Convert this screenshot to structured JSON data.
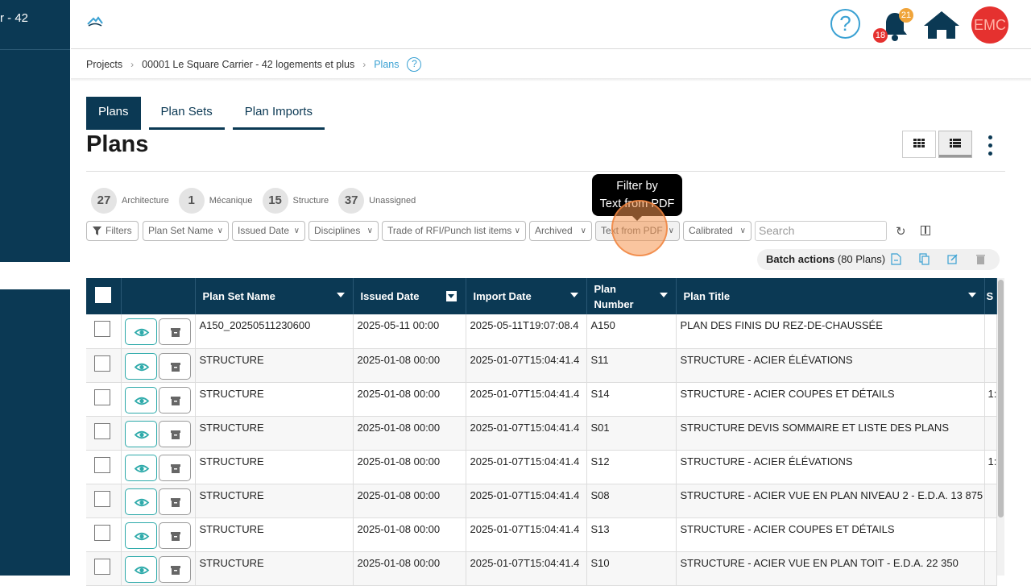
{
  "sidebar": {
    "project_fragment": "r - 42"
  },
  "header": {
    "help_label": "?",
    "notif_count": "21",
    "alert_count": "18",
    "avatar_initials": "EMC"
  },
  "breadcrumb": {
    "items": [
      "Projects",
      "00001 Le Square Carrier - 42 logements et plus",
      "Plans"
    ],
    "help": "?"
  },
  "tabs": [
    "Plans",
    "Plan Sets",
    "Plan Imports"
  ],
  "page_title": "Plans",
  "counts": [
    {
      "count": "27",
      "label": "Architecture"
    },
    {
      "count": "1",
      "label": "Mécanique"
    },
    {
      "count": "15",
      "label": "Structure"
    },
    {
      "count": "37",
      "label": "Unassigned"
    }
  ],
  "filters": {
    "filters_label": "Filters",
    "plan_set_name": "Plan Set Name",
    "issued_date": "Issued Date",
    "disciplines": "Disciplines",
    "trade": "Trade of RFI/Punch list items",
    "archived": "Archived",
    "text_from_pdf": "Text from PDF",
    "calibrated": "Calibrated",
    "search_placeholder": "Search"
  },
  "tooltip": {
    "line1": "Filter by",
    "line2": "Text from PDF"
  },
  "batch": {
    "label": "Batch actions",
    "count": "(80 Plans)"
  },
  "table": {
    "headers": [
      "Plan Set Name",
      "Issued Date",
      "Import Date",
      "Plan Number",
      "Plan Title",
      "S"
    ],
    "rows": [
      {
        "set": "A150_20250511230600",
        "issued": "2025-05-11 00:00",
        "imported": "2025-05-11T19:07:08.4",
        "number": "A150",
        "title": "PLAN DES FINIS DU REZ-DE-CHAUSSÉE",
        "extra": ""
      },
      {
        "set": "STRUCTURE",
        "issued": "2025-01-08 00:00",
        "imported": "2025-01-07T15:04:41.4",
        "number": "S11",
        "title": "STRUCTURE - ACIER ÉLÉVATIONS",
        "extra": ""
      },
      {
        "set": "STRUCTURE",
        "issued": "2025-01-08 00:00",
        "imported": "2025-01-07T15:04:41.4",
        "number": "S14",
        "title": "STRUCTURE - ACIER COUPES ET DÉTAILS",
        "extra": "1:"
      },
      {
        "set": "STRUCTURE",
        "issued": "2025-01-08 00:00",
        "imported": "2025-01-07T15:04:41.4",
        "number": "S01",
        "title": "STRUCTURE DEVIS SOMMAIRE ET LISTE DES PLANS",
        "extra": ""
      },
      {
        "set": "STRUCTURE",
        "issued": "2025-01-08 00:00",
        "imported": "2025-01-07T15:04:41.4",
        "number": "S12",
        "title": "STRUCTURE - ACIER ÉLÉVATIONS",
        "extra": "1:"
      },
      {
        "set": "STRUCTURE",
        "issued": "2025-01-08 00:00",
        "imported": "2025-01-07T15:04:41.4",
        "number": "S08",
        "title": "STRUCTURE - ACIER VUE EN PLAN NIVEAU 2 - E.D.A. 13 875",
        "extra": ""
      },
      {
        "set": "STRUCTURE",
        "issued": "2025-01-08 00:00",
        "imported": "2025-01-07T15:04:41.4",
        "number": "S13",
        "title": "STRUCTURE - ACIER COUPES ET DÉTAILS",
        "extra": ""
      },
      {
        "set": "STRUCTURE",
        "issued": "2025-01-08 00:00",
        "imported": "2025-01-07T15:04:41.4",
        "number": "S10",
        "title": "STRUCTURE - ACIER VUE EN PLAN TOIT - E.D.A. 22 350",
        "extra": ""
      }
    ]
  },
  "colors": {
    "navy": "#0b3954",
    "accent_blue": "#3aa1d3",
    "teal": "#2eaaaa",
    "red": "#e5312f",
    "orange": "#f0a43a"
  }
}
